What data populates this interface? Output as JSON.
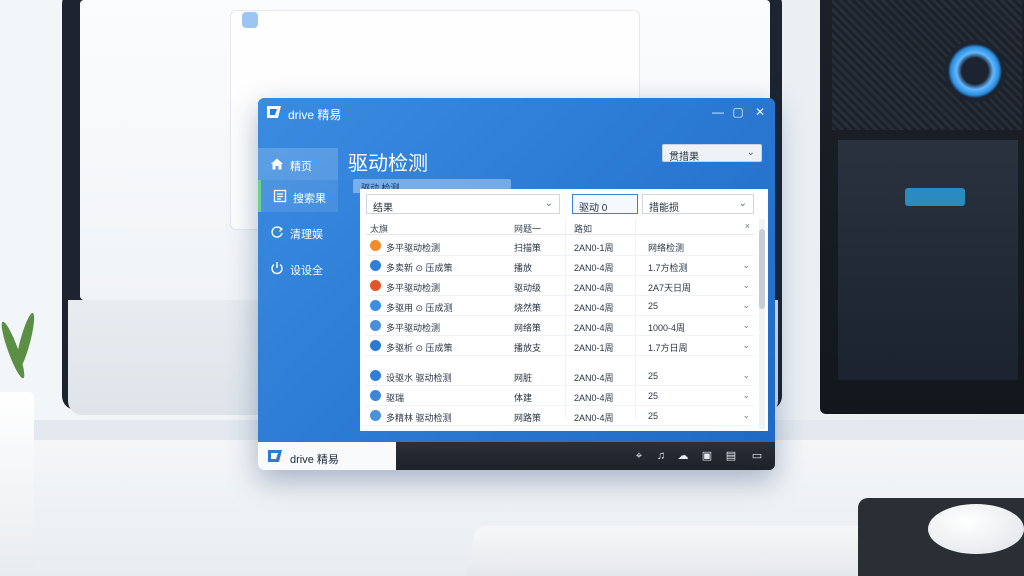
{
  "app": {
    "title": "drive 精易",
    "window_controls": {
      "minimize": "—",
      "maximize": "▢",
      "close": "✕"
    }
  },
  "sidebar": {
    "items": [
      {
        "label": "精页",
        "icon": "home-icon"
      },
      {
        "label": "搜索果",
        "icon": "list-icon"
      },
      {
        "label": "清理娱",
        "icon": "sync-icon"
      },
      {
        "label": "设设全",
        "icon": "power-icon"
      }
    ]
  },
  "main": {
    "page_title": "驱动检测",
    "top_select": "贯措果",
    "panel_tab": "驱动 检测",
    "filters": {
      "result": "结果",
      "version": "驱动 0",
      "status": "措能损"
    },
    "table": {
      "headers": [
        "太旗",
        "网题一",
        "路如"
      ],
      "rows": [
        {
          "name": "多平驱动检测",
          "icon_color": "#f08c2a",
          "type": "扫描策",
          "date": "2AN0-1周",
          "extra": "网络检测",
          "has_chevron": false
        },
        {
          "name": "多卖新  ⊙ 压成策",
          "icon_color": "#2f7fd6",
          "type": "播放",
          "date": "2AN0-4周",
          "extra": "1.7方检测",
          "has_chevron": true
        },
        {
          "name": "多平驱动检测",
          "icon_color": "#e2562b",
          "type": "驱动级",
          "date": "2AN0-4周",
          "extra": "2A7天日周",
          "has_chevron": true
        },
        {
          "name": "多驱用  ⊙ 压成测",
          "icon_color": "#3b8fe0",
          "type": "烧然策",
          "date": "2AN0-4周",
          "extra": "25",
          "has_chevron": true
        },
        {
          "name": "多平驱动检测",
          "icon_color": "#4a90d9",
          "type": "网络策",
          "date": "2AN0-4周",
          "extra": "1000-4周",
          "has_chevron": true
        },
        {
          "name": "多驱析  ⊙ 压成策",
          "icon_color": "#2a7bd0",
          "type": "播放支",
          "date": "2AN0-1周",
          "extra": "1.7方日周",
          "has_chevron": true
        },
        {
          "name": "设驱水 驱动检测",
          "icon_color": "#2f7fd6",
          "type": "网脏",
          "date": "2AN0-4周",
          "extra": "25",
          "has_chevron": true
        },
        {
          "name": "驱瑞",
          "icon_color": "#3a86d8",
          "type": "体建",
          "date": "2AN0-4周",
          "extra": "25",
          "has_chevron": true
        },
        {
          "name": "多精林 驱动检测",
          "icon_color": "#4a92da",
          "type": "网路策",
          "date": "2AN0-4周",
          "extra": "25",
          "has_chevron": true
        }
      ]
    }
  },
  "taskbar": {
    "app_label": "drive 精易",
    "tray_icons": [
      "pin-icon",
      "bell-icon",
      "cloud-icon",
      "video-icon",
      "chat-icon",
      "display-icon"
    ]
  },
  "colors": {
    "window_blue": "#2c7bd5",
    "panel_bg": "#ffffff",
    "accent_green": "#6ad28a"
  }
}
